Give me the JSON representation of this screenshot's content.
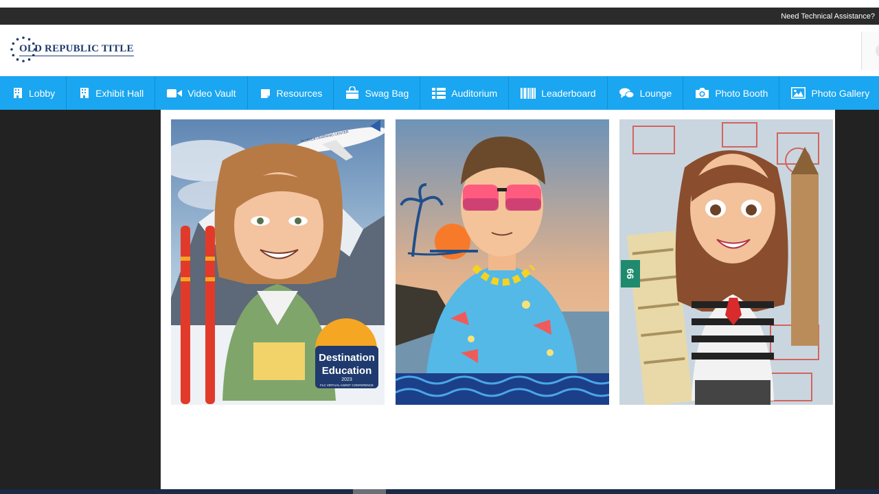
{
  "topbar": {
    "help_text": "Need Technical Assistance?"
  },
  "brand": {
    "logo_text": "OLD REPUBLIC TITLE"
  },
  "nav": {
    "items": [
      {
        "label": "Lobby",
        "icon": "building-icon"
      },
      {
        "label": "Exhibit Hall",
        "icon": "building-icon"
      },
      {
        "label": "Video Vault",
        "icon": "video-camera-icon"
      },
      {
        "label": "Resources",
        "icon": "document-icon"
      },
      {
        "label": "Swag Bag",
        "icon": "shopping-bag-icon"
      },
      {
        "label": "Auditorium",
        "icon": "grid-list-icon"
      },
      {
        "label": "Leaderboard",
        "icon": "barcode-icon"
      },
      {
        "label": "Lounge",
        "icon": "chat-bubbles-icon"
      },
      {
        "label": "Photo Booth",
        "icon": "camera-icon"
      },
      {
        "label": "Photo Gallery",
        "icon": "image-icon"
      }
    ]
  },
  "gallery": {
    "photos": [
      {
        "badge_title": "Destination Education",
        "badge_year": "2023",
        "badge_sub": "FLC VIRTUAL AGENT CONFERENCE",
        "plane_text": "FLORIDA LEARNING CENTER"
      },
      {
        "theme": "beach"
      },
      {
        "theme": "travel",
        "sign_text": "66"
      }
    ]
  },
  "colors": {
    "nav_bg": "#1aa6f0",
    "brand": "#1f3a6e",
    "dark_bg": "#222222"
  }
}
